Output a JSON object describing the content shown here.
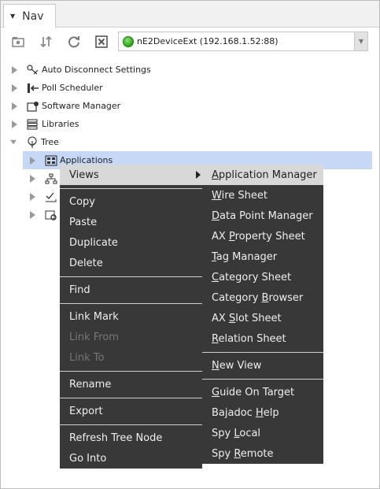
{
  "nav": {
    "tab_label": "Nav",
    "ord_text": "nE2DeviceExt (192.168.1.52:88)"
  },
  "tree": {
    "items": [
      {
        "label": "Auto Disconnect Settings"
      },
      {
        "label": "Poll Scheduler"
      },
      {
        "label": "Software Manager"
      },
      {
        "label": "Libraries"
      },
      {
        "label": "Tree"
      },
      {
        "label": "Applications"
      }
    ]
  },
  "context_menu": {
    "items": [
      {
        "label": "Views"
      },
      {
        "label": "Copy"
      },
      {
        "label": "Paste"
      },
      {
        "label": "Duplicate"
      },
      {
        "label": "Delete"
      },
      {
        "label": "Find"
      },
      {
        "label": "Link Mark"
      },
      {
        "label": "Link From"
      },
      {
        "label": "Link To"
      },
      {
        "label": "Rename"
      },
      {
        "label": "Export"
      },
      {
        "label": "Refresh Tree Node"
      },
      {
        "label": "Go Into"
      }
    ]
  },
  "views_menu": {
    "items": [
      {
        "label": "Application Manager",
        "pre": "",
        "ul": "A",
        "post": "pplication Manager"
      },
      {
        "label": "Wire Sheet",
        "pre": "",
        "ul": "W",
        "post": "ire Sheet"
      },
      {
        "label": "Data Point Manager",
        "pre": "",
        "ul": "D",
        "post": "ata Point Manager"
      },
      {
        "label": "AX Property Sheet",
        "pre": "AX ",
        "ul": "P",
        "post": "roperty Sheet"
      },
      {
        "label": "Tag Manager",
        "pre": "",
        "ul": "T",
        "post": "ag Manager"
      },
      {
        "label": "Category Sheet",
        "pre": "",
        "ul": "C",
        "post": "ategory Sheet"
      },
      {
        "label": "Category Browser",
        "pre": "Category ",
        "ul": "B",
        "post": "rowser"
      },
      {
        "label": "AX Slot Sheet",
        "pre": "AX ",
        "ul": "S",
        "post": "lot Sheet"
      },
      {
        "label": "Relation Sheet",
        "pre": "",
        "ul": "R",
        "post": "elation Sheet"
      },
      {
        "label": "New View",
        "pre": "",
        "ul": "N",
        "post": "ew View"
      },
      {
        "label": "Guide On Target",
        "pre": "",
        "ul": "G",
        "post": "uide On Target"
      },
      {
        "label": "Bajadoc Help",
        "pre": "Bajadoc ",
        "ul": "H",
        "post": "elp"
      },
      {
        "label": "Spy Local",
        "pre": "Spy ",
        "ul": "L",
        "post": "ocal"
      },
      {
        "label": "Spy Remote",
        "pre": "Spy ",
        "ul": "R",
        "post": "emote"
      }
    ]
  },
  "colors": {
    "menu_bg": "#383838",
    "highlight": "#d8d8d8",
    "selection": "#c7d8f6",
    "status_green": "#2aa414"
  }
}
